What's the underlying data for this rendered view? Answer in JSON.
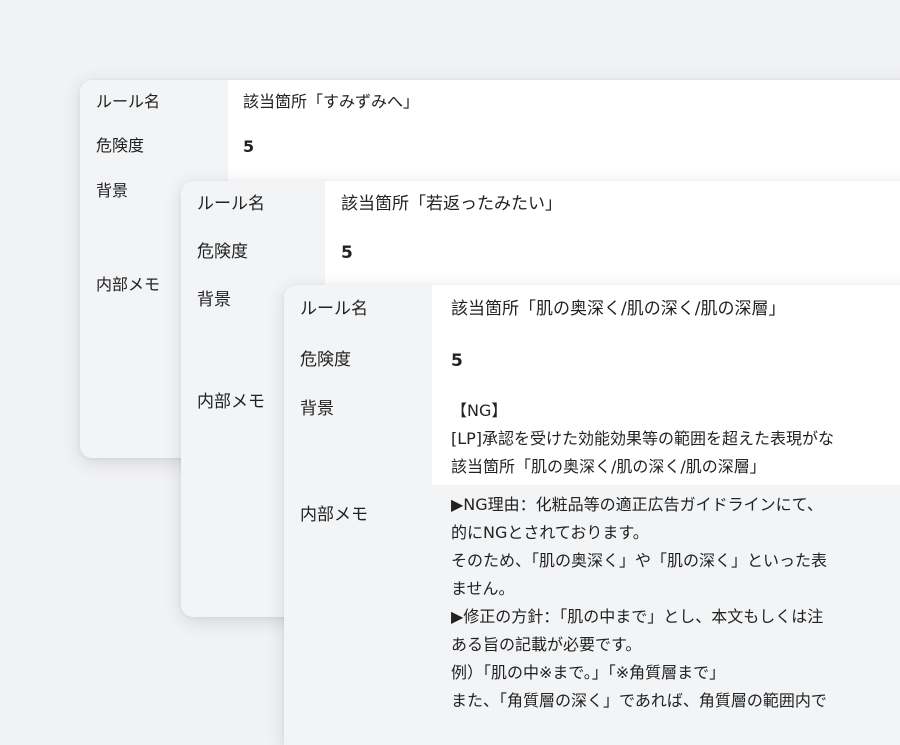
{
  "card1": {
    "rule_name_label": "ルール名",
    "rule_name_value": "該当箇所「すみずみへ」",
    "risk_label": "危険度",
    "risk_value": "5",
    "background_label": "背景",
    "memo_label": "内部メモ"
  },
  "card2": {
    "rule_name_label": "ルール名",
    "rule_name_value": "該当箇所「若返ったみたい」",
    "risk_label": "危険度",
    "risk_value": "5",
    "background_label": "背景",
    "memo_label": "内部メモ"
  },
  "card3": {
    "rule_name_label": "ルール名",
    "rule_name_value": "該当箇所「肌の奥深く/肌の深く/肌の深層」",
    "risk_label": "危険度",
    "risk_value": "5",
    "background_label": "背景",
    "background_lines": [
      "【NG】",
      "[LP]承認を受けた効能効果等の範囲を超えた表現がな",
      "該当箇所「肌の奥深く/肌の深く/肌の深層」"
    ],
    "memo_label": "内部メモ",
    "memo_lines": [
      "▶NG理由：化粧品等の適正広告ガイドラインにて、",
      "的にNGとされております。",
      "そのため、「肌の奥深く」や「肌の深く」といった表",
      "ません。",
      "▶修正の方針：「肌の中まで」とし、本文もしくは注",
      "ある旨の記載が必要です。",
      "例）「肌の中※まで。」「※角質層まで」",
      "また、「角質層の深く」であれば、角質層の範囲内で"
    ]
  }
}
